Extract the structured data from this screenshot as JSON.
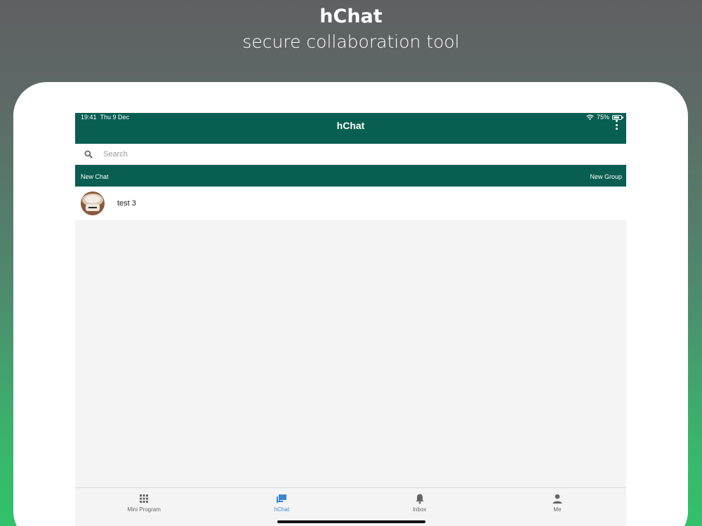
{
  "promo": {
    "title": "hChat",
    "subtitle": "secure collaboration tool"
  },
  "status_bar": {
    "time": "19:41",
    "date": "Thu 9 Dec",
    "battery": "75%"
  },
  "header": {
    "title": "hChat"
  },
  "search": {
    "placeholder": "Search",
    "value": ""
  },
  "actions": {
    "new_chat": "New Chat",
    "new_group": "New Group"
  },
  "chats": [
    {
      "name": "test 3"
    }
  ],
  "tabs": [
    {
      "label": "Mini Program",
      "icon": "grid-icon",
      "active": false
    },
    {
      "label": "hChat",
      "icon": "chat-icon",
      "active": true
    },
    {
      "label": "Inbox",
      "icon": "bell-icon",
      "active": false
    },
    {
      "label": "Me",
      "icon": "person-icon",
      "active": false
    }
  ],
  "colors": {
    "brand_green": "#095e52",
    "active_tab": "#3a86d6"
  }
}
